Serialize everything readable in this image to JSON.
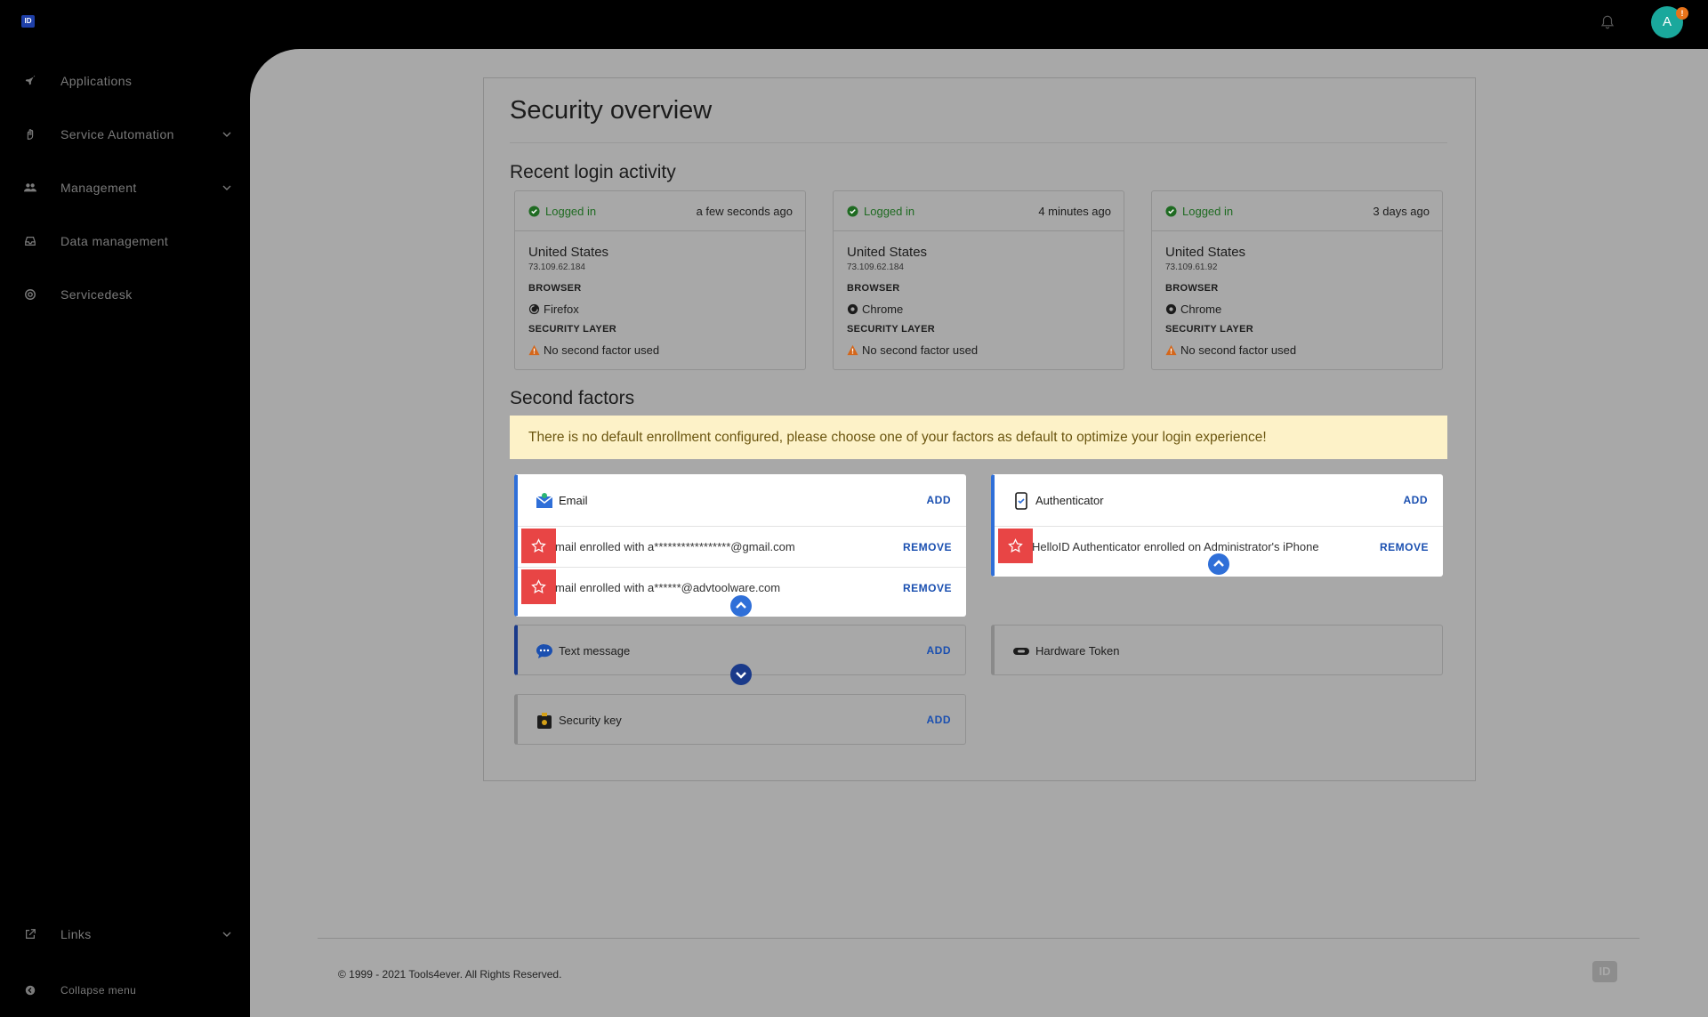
{
  "header": {
    "logo_text": "ID",
    "avatar_initial": "A",
    "notification_badge": "!"
  },
  "sidebar": {
    "items": [
      {
        "label": "Applications",
        "icon": "rocket-icon"
      },
      {
        "label": "Service Automation",
        "icon": "hand-icon"
      },
      {
        "label": "Management",
        "icon": "users-icon"
      },
      {
        "label": "Data management",
        "icon": "inbox-icon"
      },
      {
        "label": "Servicedesk",
        "icon": "lifebuoy-icon"
      }
    ],
    "links_label": "Links",
    "collapse_label": "Collapse menu"
  },
  "page": {
    "title": "Security overview",
    "recent_heading": "Recent login activity",
    "second_factors_heading": "Second factors",
    "banner": "There is no default enrollment configured, please choose one of your factors as default to optimize your login experience!"
  },
  "logins": [
    {
      "status": "Logged in",
      "time": "a few seconds ago",
      "country": "United States",
      "ip": "73.109.62.184",
      "browser_label": "BROWSER",
      "browser": "Firefox",
      "security_label": "SECURITY LAYER",
      "security": "No second factor used"
    },
    {
      "status": "Logged in",
      "time": "4 minutes ago",
      "country": "United States",
      "ip": "73.109.62.184",
      "browser_label": "BROWSER",
      "browser": "Chrome",
      "security_label": "SECURITY LAYER",
      "security": "No second factor used"
    },
    {
      "status": "Logged in",
      "time": "3 days ago",
      "country": "United States",
      "ip": "73.109.61.92",
      "browser_label": "BROWSER",
      "browser": "Chrome",
      "security_label": "SECURITY LAYER",
      "security": "No second factor used"
    }
  ],
  "factors": {
    "email": {
      "name": "Email",
      "action": "ADD",
      "entries": [
        {
          "text": "mail enrolled with a*****************@gmail.com",
          "action": "REMOVE"
        },
        {
          "text": "mail enrolled with a******@advtoolware.com",
          "action": "REMOVE"
        }
      ]
    },
    "authenticator": {
      "name": "Authenticator",
      "action": "ADD",
      "entries": [
        {
          "text": "HelloID Authenticator enrolled on Administrator's iPhone",
          "action": "REMOVE"
        }
      ]
    },
    "text_message": {
      "name": "Text message",
      "action": "ADD"
    },
    "hardware_token": {
      "name": "Hardware Token"
    },
    "security_key": {
      "name": "Security key",
      "action": "ADD"
    }
  },
  "footer": {
    "copyright": "© 1999 - 2021 Tools4ever. All Rights Reserved.",
    "logo_text": "ID"
  },
  "colors": {
    "accent": "#2f6fd8",
    "dark_accent": "#1a3a8a",
    "logged_in": "#1f6b22",
    "warning": "#e8731a",
    "highlight": "#e84545",
    "banner_bg": "#fdf2c8"
  }
}
